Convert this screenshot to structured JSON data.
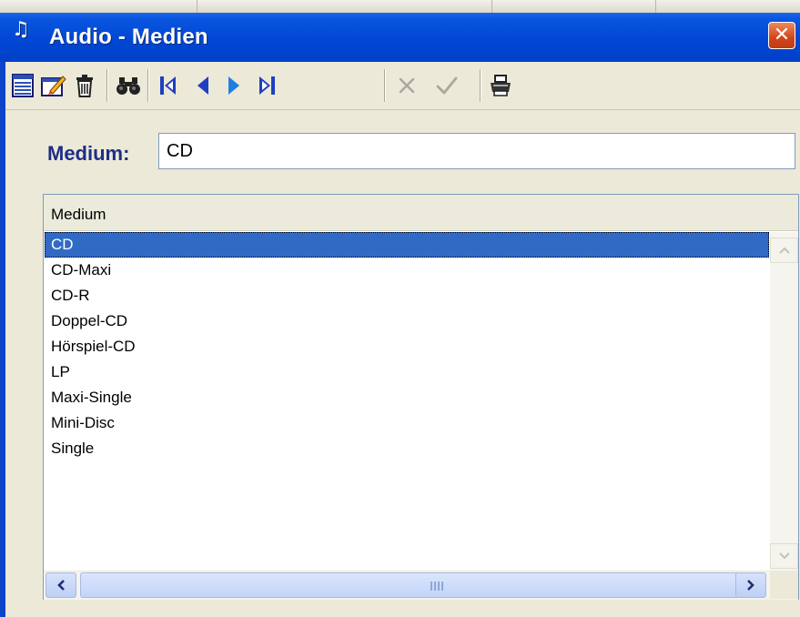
{
  "window": {
    "title": "Audio - Medien",
    "app_icon": "music-note-icon",
    "close_icon": "close-x-icon"
  },
  "toolbar": {
    "buttons": [
      {
        "name": "list-view-button",
        "icon": "list-icon",
        "enabled": true
      },
      {
        "name": "edit-record-button",
        "icon": "edit-icon",
        "enabled": true
      },
      {
        "name": "delete-record-button",
        "icon": "trash-icon",
        "enabled": true
      },
      {
        "name": "search-button",
        "icon": "binoculars-icon",
        "enabled": true
      },
      {
        "name": "first-record-button",
        "icon": "first-icon",
        "enabled": true
      },
      {
        "name": "previous-record-button",
        "icon": "previous-icon",
        "enabled": true
      },
      {
        "name": "next-record-button",
        "icon": "next-icon",
        "enabled": true
      },
      {
        "name": "last-record-button",
        "icon": "last-icon",
        "enabled": true
      },
      {
        "name": "cancel-button",
        "icon": "cancel-x-icon",
        "enabled": false
      },
      {
        "name": "confirm-button",
        "icon": "checkmark-icon",
        "enabled": false
      },
      {
        "name": "print-button",
        "icon": "printer-icon",
        "enabled": true
      }
    ]
  },
  "form": {
    "medium_label": "Medium:",
    "medium_value": "CD"
  },
  "list": {
    "column_header": "Medium",
    "selected_index": 0,
    "items": [
      "CD",
      "CD-Maxi",
      "CD-R",
      "Doppel-CD",
      "Hörspiel-CD",
      "LP",
      "Maxi-Single",
      "Mini-Disc",
      "Single"
    ]
  },
  "colors": {
    "titlebar": "#0047d4",
    "label": "#1e2d86",
    "selection": "#316ac5",
    "close_button": "#d2441a"
  }
}
